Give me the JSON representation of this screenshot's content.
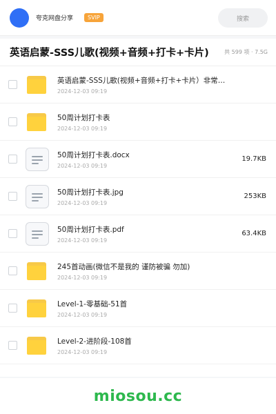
{
  "header": {
    "brand": "夸克网盘分享",
    "vip_badge": "SVIP",
    "search_label": "搜索"
  },
  "folder": {
    "title": "英语启蒙-SSS儿歌(视频+音频+打卡+卡片)",
    "meta": "共 599 项 · 7.5G"
  },
  "files": [
    {
      "type": "folder",
      "name": "英语启蒙-SSS儿歌(视频+音频+打卡+卡片）非常棒的资源",
      "date": "2024-12-03 09:19",
      "size": ""
    },
    {
      "type": "folder",
      "name": "50周计划打卡表",
      "date": "2024-12-03 09:19",
      "size": ""
    },
    {
      "type": "doc",
      "name": "50周计划打卡表.docx",
      "date": "2024-12-03 09:19",
      "size": "19.7KB"
    },
    {
      "type": "doc",
      "name": "50周计划打卡表.jpg",
      "date": "2024-12-03 09:19",
      "size": "253KB"
    },
    {
      "type": "doc",
      "name": "50周计划打卡表.pdf",
      "date": "2024-12-03 09:19",
      "size": "63.4KB"
    },
    {
      "type": "folder",
      "name": "245首动画(微信不是我的 谨防被骗 勿加)",
      "date": "2024-12-03 09:19",
      "size": ""
    },
    {
      "type": "folder",
      "name": "Level-1-零基础-51首",
      "date": "2024-12-03 09:19",
      "size": ""
    },
    {
      "type": "folder",
      "name": "Level-2-进阶段-108首",
      "date": "2024-12-03 09:19",
      "size": ""
    }
  ],
  "watermark": "miosou.cc"
}
